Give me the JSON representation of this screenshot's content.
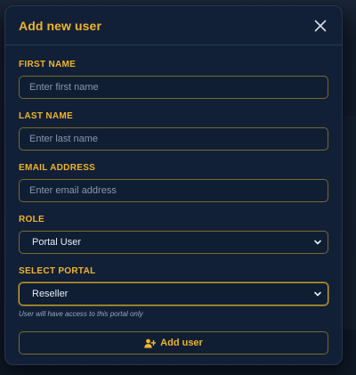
{
  "modal": {
    "title": "Add new user",
    "close_icon": "close-icon"
  },
  "form": {
    "first_name": {
      "label": "FIRST NAME",
      "value": "",
      "placeholder": "Enter first name"
    },
    "last_name": {
      "label": "LAST NAME",
      "value": "",
      "placeholder": "Enter last name"
    },
    "email": {
      "label": "EMAIL ADDRESS",
      "value": "",
      "placeholder": "Enter email address"
    },
    "role": {
      "label": "ROLE",
      "selected": "Portal User"
    },
    "portal": {
      "label": "SELECT PORTAL",
      "selected": "Reseller",
      "helper": "User will have access to this portal only"
    },
    "submit": {
      "label": "Add user",
      "icon": "user-plus-icon"
    }
  },
  "colors": {
    "accent": "#f0b429",
    "modal_bg": "#112036",
    "input_border": "#7a6a2e",
    "focus_border": "#c9a227"
  }
}
